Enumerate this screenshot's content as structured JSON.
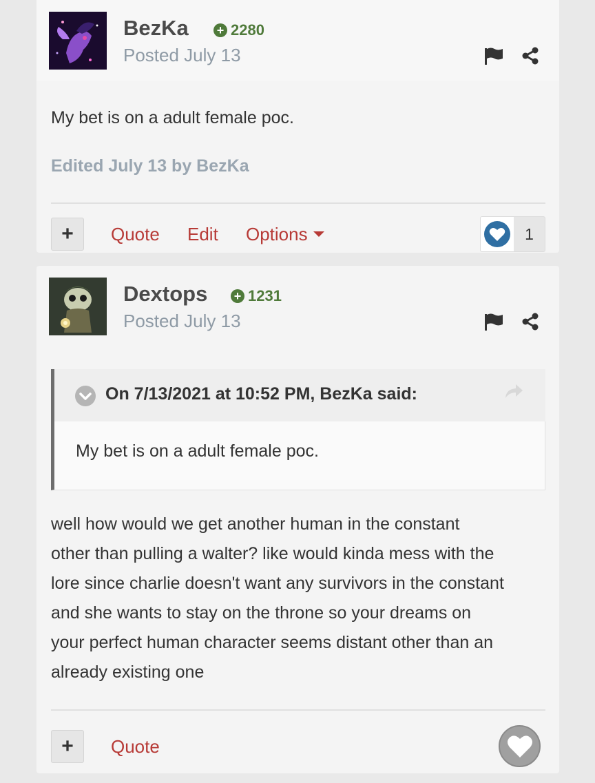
{
  "posts": [
    {
      "author": "BezKa",
      "reputation": "2280",
      "posted": "Posted July 13",
      "content": "My bet is on a adult female poc.",
      "edited": "Edited July 13 by BezKa",
      "actions": {
        "quote": "Quote",
        "edit": "Edit",
        "options": "Options"
      },
      "like_count": "1"
    },
    {
      "author": "Dextops",
      "reputation": "1231",
      "posted": "Posted July 13",
      "quote": {
        "citation": "On 7/13/2021 at 10:52 PM, BezKa said:",
        "text": "My bet is on a adult female poc."
      },
      "content_lines": [
        "well how would we get another human in the constant",
        "other than pulling a walter? like would kinda mess with the",
        "lore since charlie doesn't want any survivors in the constant",
        "and she wants to stay on the throne so your dreams on",
        "your perfect human character seems distant other than an",
        "already existing one"
      ],
      "actions": {
        "quote": "Quote"
      }
    }
  ],
  "icons": {
    "reputation": "plus-circle-icon",
    "report": "flag-icon",
    "share": "share-icon",
    "like": "heart-icon",
    "collapse": "chevron-down-icon",
    "goto": "reply-arrow-icon"
  },
  "colors": {
    "reputation": "#4f7a3a",
    "action_link": "#b73a36",
    "like_active": "#2f6fa3",
    "muted": "#8e9aa5"
  },
  "plus_label": "+"
}
